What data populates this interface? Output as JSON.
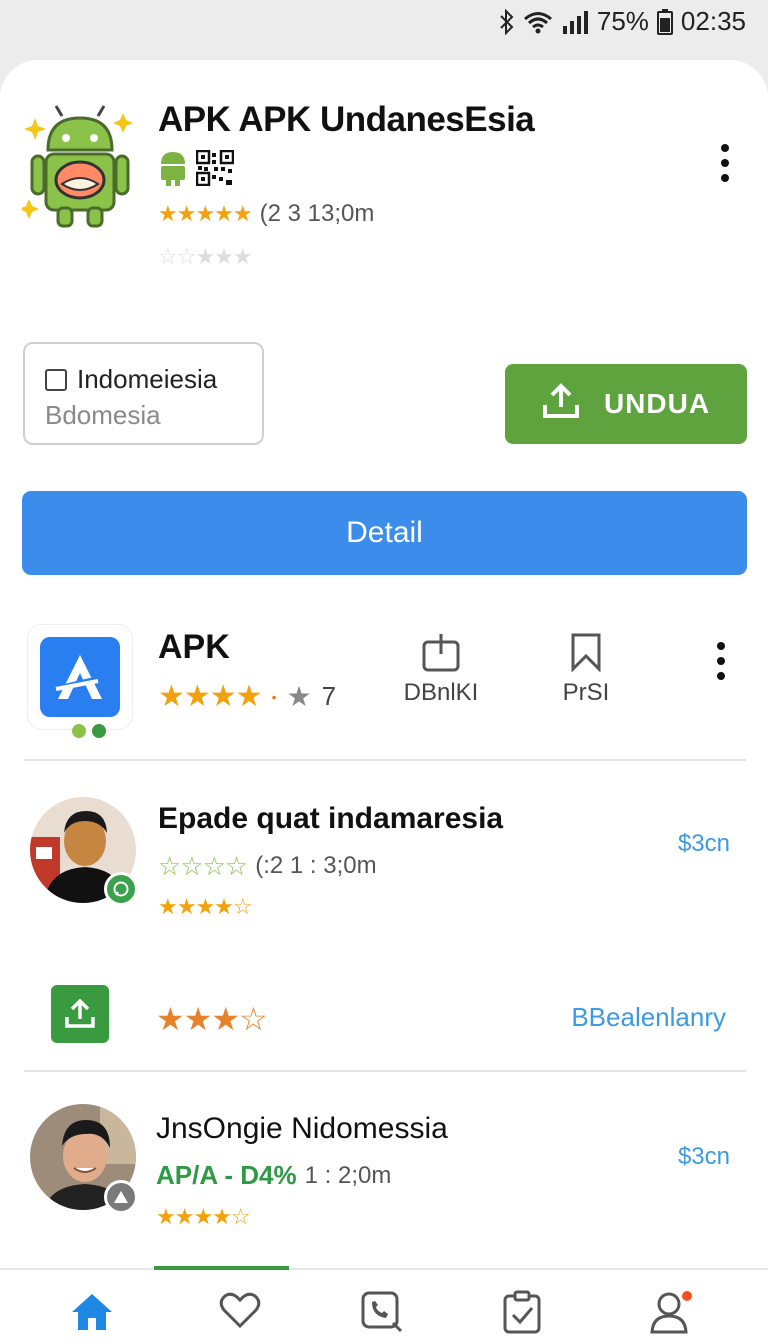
{
  "status": {
    "battery": "75%",
    "time": "02:35"
  },
  "top_app": {
    "title": "APK APK UndanesEsia",
    "rating_text": "(2 3 13;0m",
    "stars": "★★★★★",
    "stars2": "☆☆★★★"
  },
  "language": {
    "label": "Indomeiesia",
    "sub": "Bdomesia"
  },
  "undua_label": "UNDUA",
  "detail_label": "Detail",
  "apk_row": {
    "title": "APK",
    "stars": "★★★★",
    "count": "7",
    "download_label": "DBnlKI",
    "save_label": "PrSI"
  },
  "items": [
    {
      "title": "Epade quat indamaresia",
      "meta": "(:2 1 : 3;0m",
      "price": "$3cn",
      "stars_outline": "☆☆☆☆",
      "stars": "★★★★☆"
    },
    {
      "title": "JnsOngie Nidomessia",
      "tag": "AP/A - D4%",
      "meta": "1 : 2;0m",
      "price": "$3cn",
      "stars": "★★★★☆"
    }
  ],
  "upload_row": {
    "stars": "★★★☆",
    "link": "BBealenlanry"
  },
  "nav": {
    "home_label": "Home"
  },
  "colors": {
    "green": "#5fa33f",
    "blue": "#3c8cec",
    "link": "#3c9be0",
    "star": "#f2a20c"
  }
}
